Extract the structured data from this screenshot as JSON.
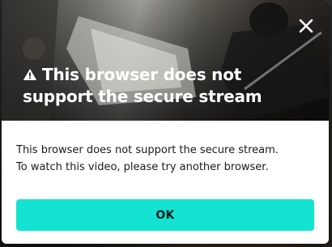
{
  "dialog": {
    "title": "This browser does not support the secure stream",
    "title_icon": "warning-icon",
    "close_icon": "close-icon",
    "message_line1": "This browser does not support the secure stream.",
    "message_line2": "To watch this video, please try another browser.",
    "ok_label": "OK"
  },
  "colors": {
    "accent": "#14e3d2",
    "title_text": "#ffffff",
    "body_text": "#1a1a1a",
    "modal_background": "#ffffff"
  }
}
